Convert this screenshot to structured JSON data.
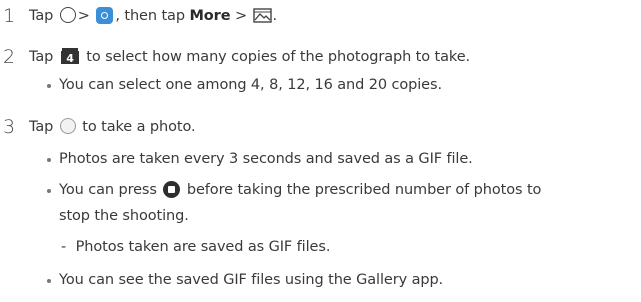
{
  "steps": [
    {
      "num": "1",
      "text_a": "Tap",
      "text_b": ">",
      "text_c": ", then tap",
      "more": "More",
      "text_d": ">",
      "text_e": "."
    },
    {
      "num": "2",
      "text_a": "Tap",
      "copies_icon_digit": "4",
      "text_b": "to select how many copies of the photograph to take.",
      "bullet_1": "You can select one among 4, 8, 12, 16 and 20 copies."
    },
    {
      "num": "3",
      "text_a": "Tap",
      "text_b": "to take a photo.",
      "bullet_1": "Photos are taken every 3 seconds and saved as a GIF file.",
      "bullet_2_a": "You can press",
      "bullet_2_b": "before taking the prescribed number of photos to",
      "bullet_2_c": "stop the shooting.",
      "sub_1": "Photos taken are saved as GIF files.",
      "bullet_3": "You can see the saved GIF files using the Gallery app."
    }
  ],
  "icons": {
    "home_circle": "circle-outline-icon",
    "camera": "camera-app-icon",
    "gif_mode": "gif-mode-icon",
    "copies": "copies-count-icon",
    "shutter": "shutter-icon",
    "stop": "stop-icon"
  },
  "colors": {
    "camera_icon": "#3a8fd6",
    "text": "#3a3a3a"
  }
}
